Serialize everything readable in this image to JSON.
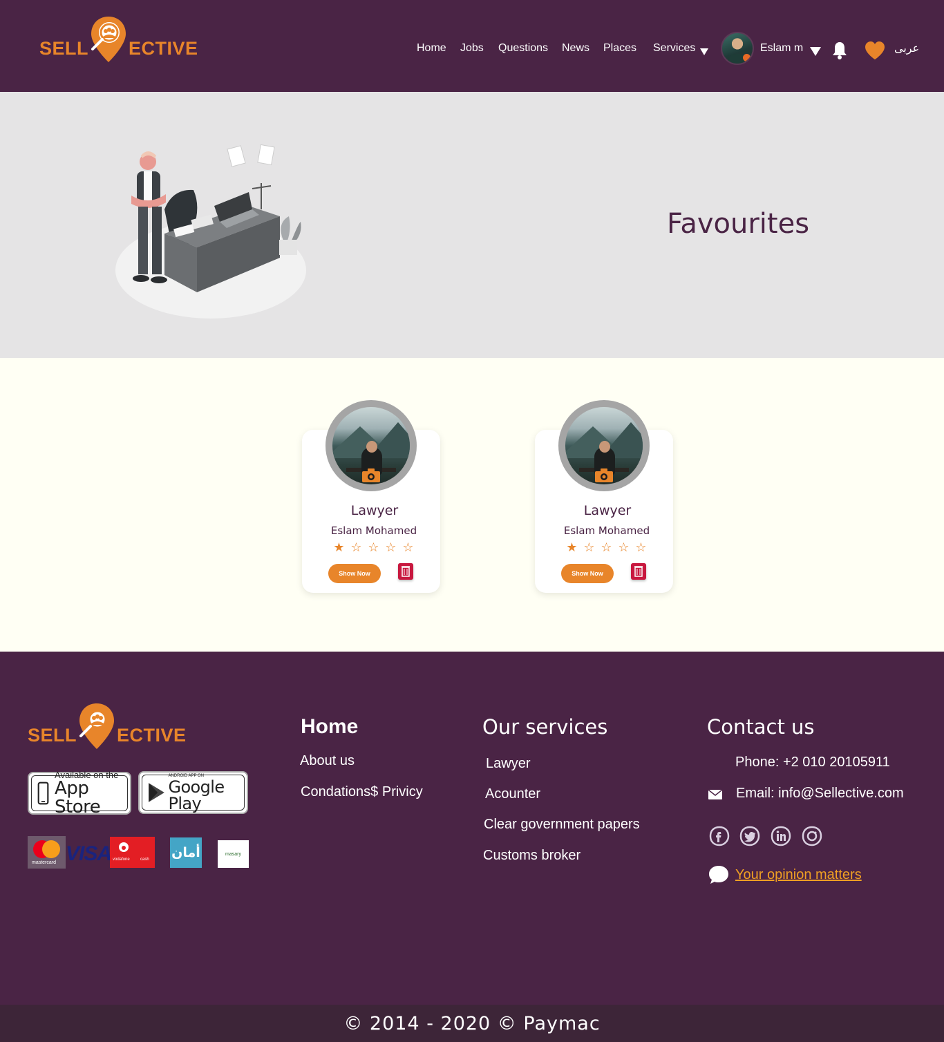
{
  "brand": {
    "logo_left": "SELL",
    "logo_right": "ECTIVE",
    "orange": "#e8852a",
    "purple": "#4a2445"
  },
  "nav": {
    "items": [
      "Home",
      "Jobs",
      "Questions",
      "News",
      "Places",
      "Services"
    ],
    "user_name": "Eslam m",
    "language": "عربى",
    "icons": [
      "chevron-down-icon",
      "bell-icon",
      "heart-icon"
    ]
  },
  "hero": {
    "title": "Favourites"
  },
  "favourites": [
    {
      "role": "Lawyer",
      "name": "Eslam Mohamed",
      "rating": 1,
      "rating_max": 5,
      "show_label": "Show Now"
    },
    {
      "role": "Lawyer",
      "name": "Eslam Mohamed",
      "rating": 1,
      "rating_max": 5,
      "show_label": "Show Now"
    }
  ],
  "footer": {
    "stores": {
      "app_store_small": "Available on the",
      "app_store_big": "App Store",
      "google_small": "ANDROID APP ON",
      "google_big": "Google Play"
    },
    "payments": {
      "mastercard": "mastercard",
      "visa": "VISA",
      "vodafone": "vodafone",
      "vodafone_cash": "cash",
      "aman": "أمان",
      "masary": "masary"
    },
    "home_col": {
      "title": "Home",
      "links": [
        "About us",
        "Condations$ Privicy"
      ]
    },
    "services_col": {
      "title": "Our services",
      "links": [
        "Lawyer",
        "Acounter",
        "Clear government papers",
        "Customs broker"
      ]
    },
    "contact_col": {
      "title": "Contact us",
      "phone": "Phone: +2 010 20105911",
      "email": "Email: info@Sellective.com",
      "social": [
        "facebook-icon",
        "twitter-icon",
        "linkedin-icon",
        "instagram-icon"
      ],
      "opinion": "Your opinion matters"
    },
    "copyright": "© 2014 - 2020 © Paymac"
  }
}
